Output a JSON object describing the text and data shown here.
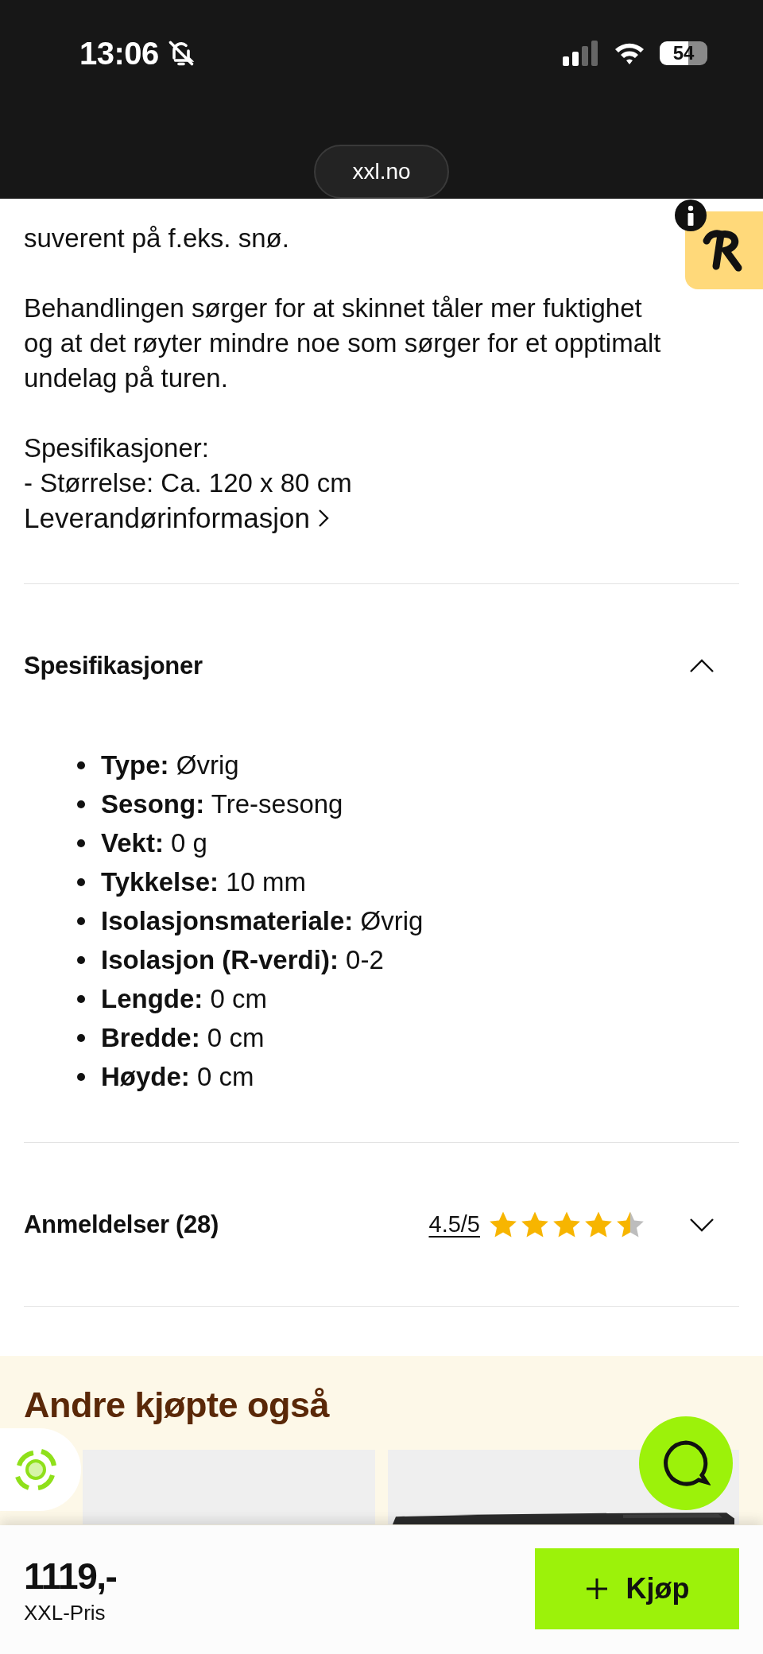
{
  "status_bar": {
    "time": "13:06",
    "battery": "54"
  },
  "browser": {
    "url": "xxl.no"
  },
  "description": {
    "paragraphs": [
      "suverent på f.eks. snø.",
      "Behandlingen sørger for at skinnet tåler mer fuktighet og at det røyter mindre noe som sørger for et opptimalt undelag på turen.",
      "Spesifikasjoner:\n- Størrelse: Ca. 120 x 80 cm"
    ]
  },
  "supplier_link": {
    "label": "Leverandørinformasjon"
  },
  "sections": [
    {
      "title": "Spesifikasjoner",
      "expanded": true,
      "items": [
        {
          "label": "Type:",
          "value": "Øvrig"
        },
        {
          "label": "Sesong:",
          "value": "Tre-sesong"
        },
        {
          "label": "Vekt:",
          "value": "0 g"
        },
        {
          "label": "Tykkelse:",
          "value": "10 mm"
        },
        {
          "label": "Isolasjonsmateriale:",
          "value": "Øvrig"
        },
        {
          "label": "Isolasjon (R-verdi):",
          "value": "0-2"
        },
        {
          "label": "Lengde:",
          "value": "0 cm"
        },
        {
          "label": "Bredde:",
          "value": "0 cm"
        },
        {
          "label": "Høyde:",
          "value": "0 cm"
        }
      ]
    },
    {
      "title": "Anmeldelser (28)",
      "expanded": false,
      "rating": "4.5/5",
      "stars": 4.5
    }
  ],
  "recommendations": {
    "title": "Andre kjøpte også"
  },
  "buy_bar": {
    "price": "1119,-",
    "price_label": "XXL-Pris",
    "button": "Kjøp"
  }
}
